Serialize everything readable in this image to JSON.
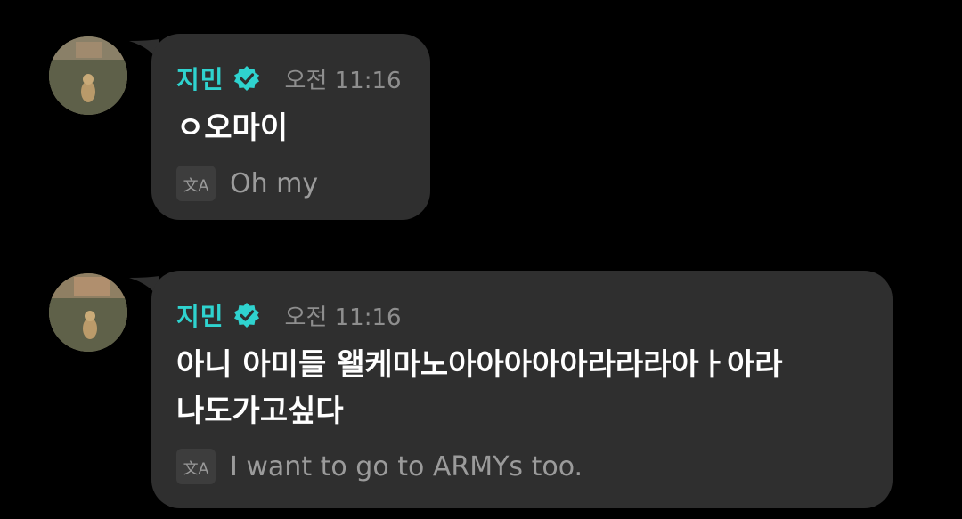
{
  "messages": [
    {
      "sender": "지민",
      "time": "오전 11:16",
      "text_lines": [
        "ㅇ오마이"
      ],
      "translation": "Oh my",
      "translate_icon": "文A",
      "verified_icon": "verified-badge-icon"
    },
    {
      "sender": "지민",
      "time": "오전 11:16",
      "text_lines": [
        "아니 아미들 왤케마노아아아아아라라라아ㅏ아라",
        "나도가고싶다"
      ],
      "translation": "I want to go to ARMYs too.",
      "translate_icon": "文A",
      "verified_icon": "verified-badge-icon"
    }
  ],
  "colors": {
    "background": "#000000",
    "bubble": "#2f2f2f",
    "name": "#2fd3cf",
    "time": "#8e8e8e",
    "text": "#ffffff",
    "translation": "#9b9b9b"
  }
}
